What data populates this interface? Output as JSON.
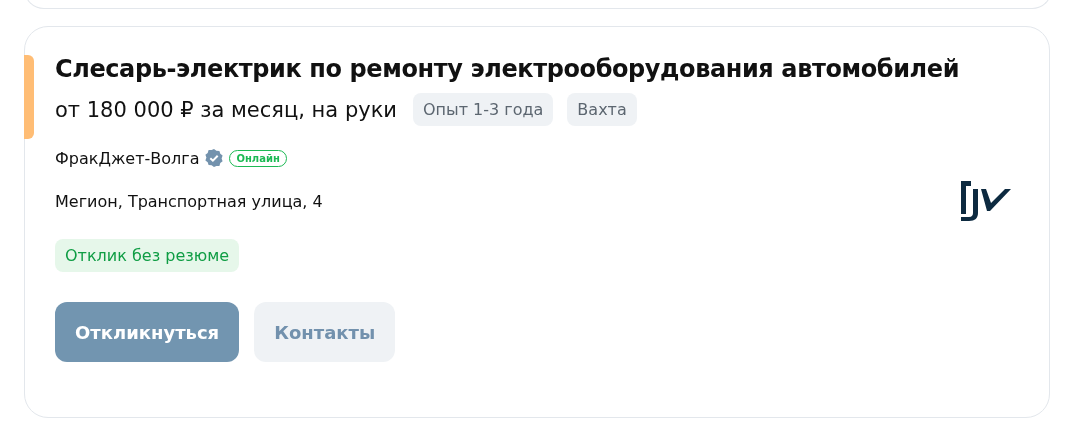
{
  "vacancy": {
    "highlighted": true,
    "title": "Слесарь-электрик по ремонту электрооборудования автомобилей",
    "salary": "от 180 000 ₽ за месяц, на руки",
    "tags": [
      "Опыт 1-3 года",
      "Вахта"
    ],
    "company": {
      "name": "ФракДжет-Волга",
      "verified": true,
      "status": "Онлайн"
    },
    "address": "Мегион, Транспортная улица, 4",
    "badge": "Отклик без резюме",
    "buttons": [
      {
        "label": "Откликнуться",
        "kind": "primary"
      },
      {
        "label": "Контакты",
        "kind": "secondary"
      }
    ]
  }
}
